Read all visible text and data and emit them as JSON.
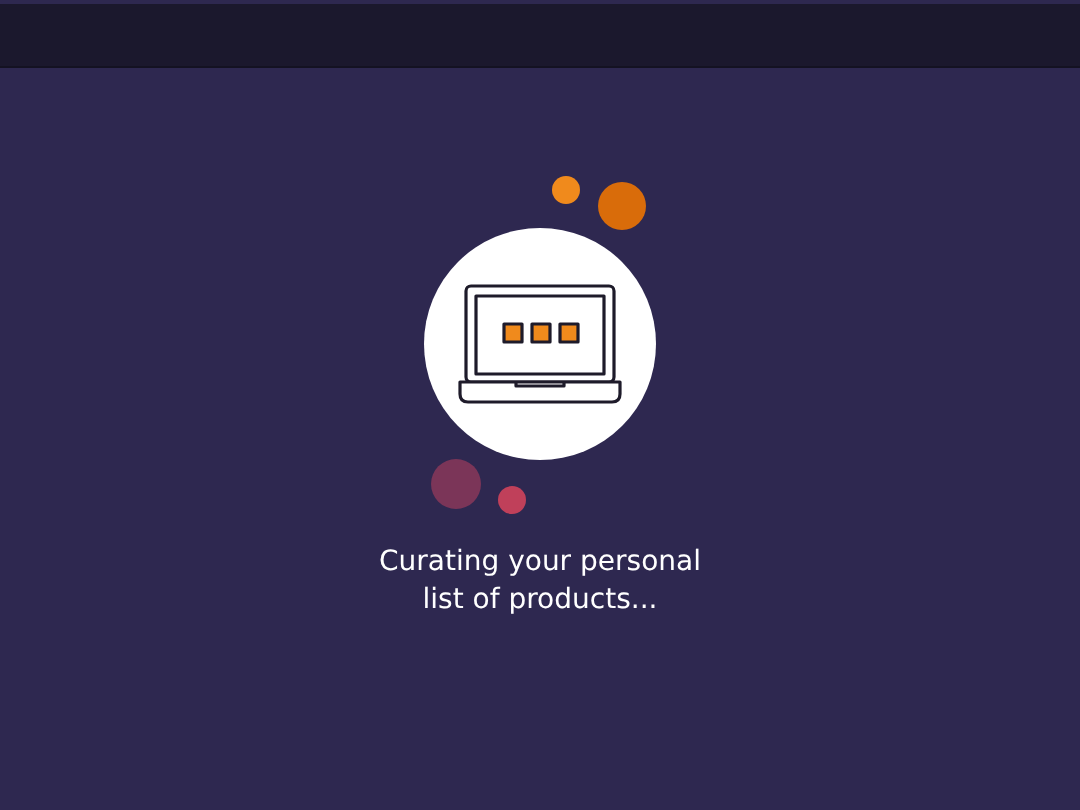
{
  "loading": {
    "message": "Curating your personal list of products..."
  }
}
